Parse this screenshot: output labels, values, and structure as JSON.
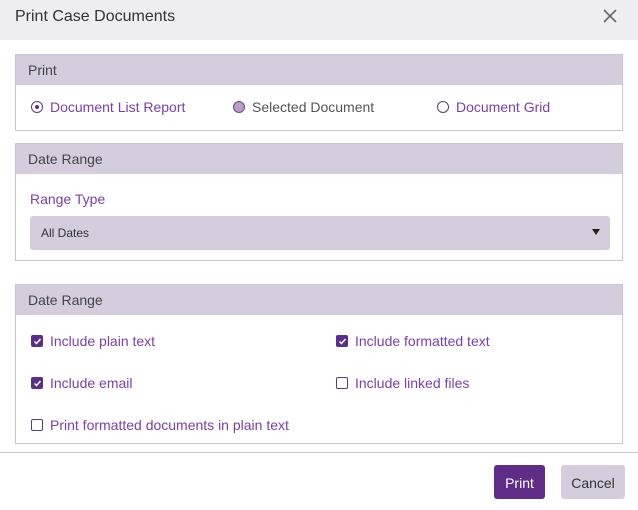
{
  "dialog": {
    "title": "Print Case Documents",
    "close_icon": "close-icon"
  },
  "print_section": {
    "header": "Print",
    "options": [
      {
        "label": "Document List Report",
        "state": "checked"
      },
      {
        "label": "Selected Document",
        "state": "filled"
      },
      {
        "label": "Document Grid",
        "state": "unchecked"
      }
    ]
  },
  "date_range_section": {
    "header": "Date Range",
    "range_type_label": "Range Type",
    "range_type_value": "All Dates"
  },
  "options_section": {
    "header": "Date Range",
    "checkboxes": [
      {
        "label": "Include plain text",
        "checked": true
      },
      {
        "label": "Include formatted text",
        "checked": true
      },
      {
        "label": "Include email",
        "checked": true
      },
      {
        "label": "Include linked files",
        "checked": false
      },
      {
        "label": "Print formatted documents in plain text",
        "checked": false
      }
    ]
  },
  "footer": {
    "print_label": "Print",
    "cancel_label": "Cancel"
  },
  "colors": {
    "accent": "#5f2d87",
    "header_bg": "#d5cddd",
    "label_text": "#7b3fa8"
  }
}
